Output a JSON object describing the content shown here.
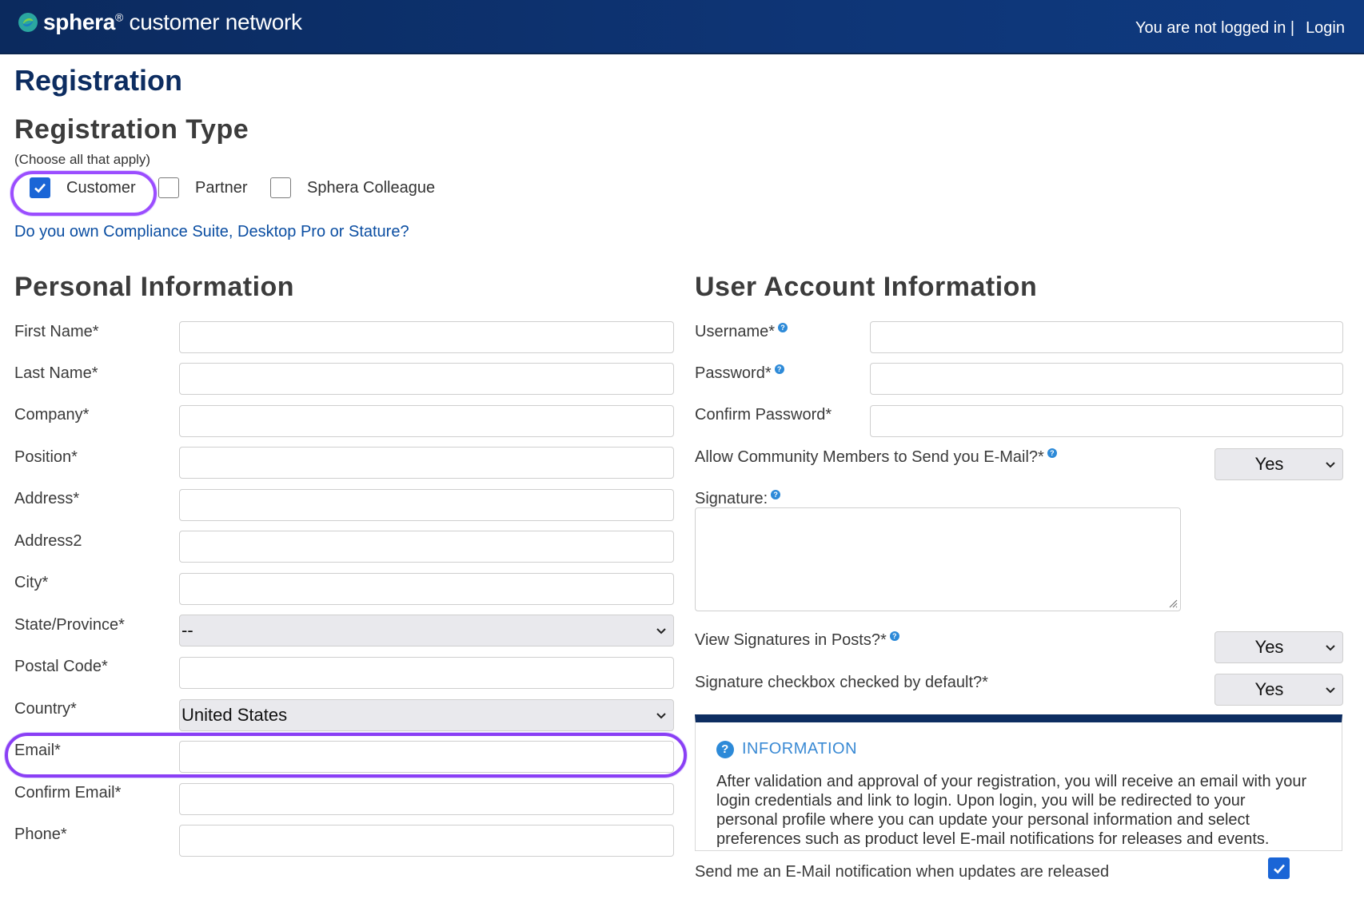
{
  "header": {
    "logo_brand": "sphera",
    "logo_suffix": "customer network",
    "status_text": "You are not logged in |",
    "login_label": "Login"
  },
  "page": {
    "title": "Registration"
  },
  "registration_type": {
    "heading": "Registration Type",
    "hint": "(Choose all that apply)",
    "options": [
      {
        "label": "Customer",
        "checked": true
      },
      {
        "label": "Partner",
        "checked": false
      },
      {
        "label": "Sphera Colleague",
        "checked": false
      }
    ],
    "link": "Do you own Compliance Suite, Desktop Pro or Stature?"
  },
  "personal": {
    "heading": "Personal Information",
    "fields": {
      "first_name": {
        "label": "First Name*",
        "value": ""
      },
      "last_name": {
        "label": "Last Name*",
        "value": ""
      },
      "company": {
        "label": "Company*",
        "value": ""
      },
      "position": {
        "label": "Position*",
        "value": ""
      },
      "address": {
        "label": "Address*",
        "value": ""
      },
      "address2": {
        "label": "Address2",
        "value": ""
      },
      "city": {
        "label": "City*",
        "value": ""
      },
      "state": {
        "label": "State/Province*",
        "value": "--"
      },
      "postal": {
        "label": "Postal Code*",
        "value": ""
      },
      "country": {
        "label": "Country*",
        "value": "United States"
      },
      "email": {
        "label": "Email*",
        "value": ""
      },
      "confirm_email": {
        "label": "Confirm Email*",
        "value": ""
      },
      "phone": {
        "label": "Phone*",
        "value": ""
      }
    }
  },
  "account": {
    "heading": "User Account Information",
    "username_label": "Username*",
    "password_label": "Password*",
    "confirm_password_label": "Confirm Password*",
    "allow_email_label": "Allow Community Members to Send you E-Mail?*",
    "allow_email_value": "Yes",
    "signature_label": "Signature:",
    "view_signatures_label": "View Signatures in Posts?*",
    "view_signatures_value": "Yes",
    "signature_default_label": "Signature checkbox checked by default?*",
    "signature_default_value": "Yes"
  },
  "info": {
    "title": "INFORMATION",
    "text": "After validation and approval of your registration, you will receive an email with your login credentials and link to login. Upon login, you will be redirected to your personal profile where you can update your personal information and select preferences such as product level E-mail notifications for releases and events."
  },
  "notify": {
    "label": "Send me an E-Mail notification when updates are released",
    "checked": true
  },
  "colors": {
    "header_bg": "#0e3576",
    "title": "#0d2d61",
    "link": "#0b4ea2",
    "highlight": "#9b4dff",
    "checkbox_checked": "#1a65d6"
  }
}
